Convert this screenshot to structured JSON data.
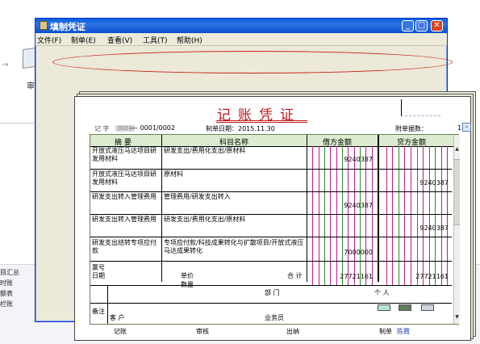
{
  "background": {
    "left_label": "审",
    "bottom_labels": [
      "目汇总",
      "时账",
      "额表",
      "栏账"
    ]
  },
  "window": {
    "title": "填制凭证",
    "controls": {
      "minimize": "_",
      "maximize": "□",
      "close": "✕"
    }
  },
  "menu": [
    "文件(F)",
    "制单(E)",
    "查看(V)",
    "工具(T)",
    "帮助(H)"
  ],
  "voucher": {
    "title": "记账凭证",
    "type_label": "记 字",
    "number": "0024",
    "page": "— 0001/0002",
    "date_label": "制单日期：2015.11.30",
    "attachments_label": "附单据数：",
    "attachments_value": "1",
    "columns": {
      "summary": "摘 要",
      "account": "科目名称",
      "debit": "借方金额",
      "credit": "贷方金额"
    },
    "rows": [
      {
        "summary": "开放式液压马达项目研发用材料",
        "account": "研发支出/费用化支出/原材料",
        "debit": "9240387",
        "credit": ""
      },
      {
        "summary": "开放式液压马达项目研发用材料",
        "account": "原材料",
        "debit": "",
        "credit": "9240387"
      },
      {
        "summary": "研发支出转入管理费用",
        "account": "管理费用/研发支出转入",
        "debit": "9240387",
        "credit": ""
      },
      {
        "summary": "研发支出转入管理费用",
        "account": "研发支出/费用化支出/原材料",
        "debit": "",
        "credit": "9240387"
      },
      {
        "summary": "研发支出结转专项应付款",
        "account": "专项应付款/科技成果转化与扩散项目/开放式液压马达成果转化",
        "debit": "7000000",
        "credit": ""
      }
    ],
    "totals": {
      "ticket_no_label": "票号",
      "date_label": "日期",
      "unit_price_label": "单价",
      "quantity_label": "数量",
      "total_label": "合 计",
      "debit_total": "27721161",
      "credit_total": "27721161"
    },
    "remarks": {
      "label": "备注",
      "dept_label": "部 门",
      "person_label": "个 人",
      "customer_label": "客 户",
      "salesperson_label": "业务员"
    },
    "footer": {
      "bookkeeping": "记账",
      "audit": "审核",
      "cashier": "出纳",
      "maker_label": "制单",
      "maker_name": "陈霞"
    }
  },
  "colors": {
    "title_red": "#c0151a",
    "header_green": "#dcebd0",
    "grid_magenta": "#c2188f",
    "grid_green": "#2f8a2f",
    "maker_blue": "#1a3fb0"
  }
}
